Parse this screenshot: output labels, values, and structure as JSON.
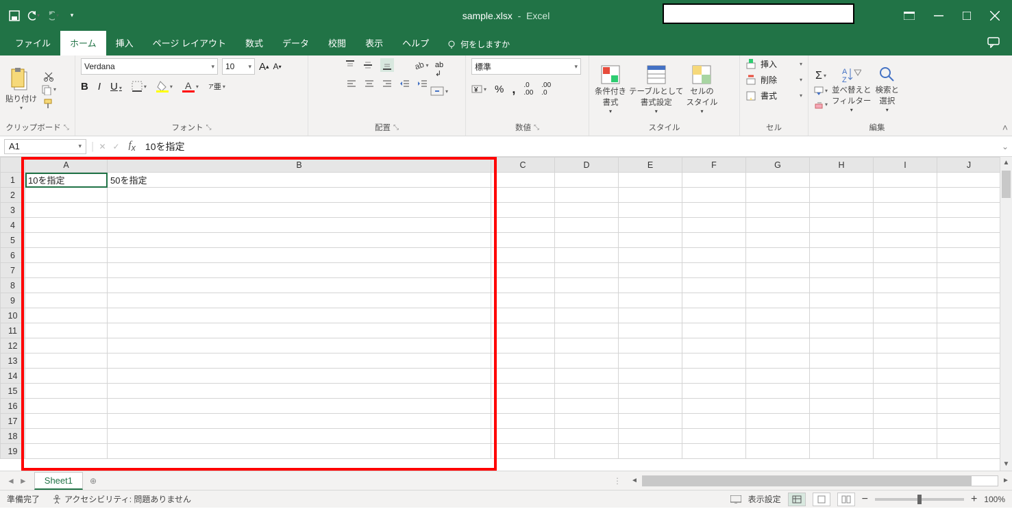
{
  "title": {
    "filename": "sample.xlsx",
    "app": "Excel"
  },
  "qat": {
    "save": "save",
    "undo": "undo",
    "redo": "redo"
  },
  "tabs": {
    "file": "ファイル",
    "home": "ホーム",
    "insert": "挿入",
    "pagelayout": "ページ レイアウト",
    "formulas": "数式",
    "data": "データ",
    "review": "校閲",
    "view": "表示",
    "help": "ヘルプ",
    "tellme": "何をしますか"
  },
  "ribbon": {
    "clipboard": {
      "paste": "貼り付け",
      "label": "クリップボード"
    },
    "font": {
      "name": "Verdana",
      "size": "10",
      "label": "フォント",
      "bold": "B",
      "italic": "I",
      "underline": "U"
    },
    "alignment": {
      "label": "配置",
      "wrap": "ab↲"
    },
    "number": {
      "format": "標準",
      "label": "数値"
    },
    "styles": {
      "cond": "条件付き\n書式",
      "table": "テーブルとして\n書式設定",
      "cell": "セルの\nスタイル",
      "label": "スタイル"
    },
    "cells": {
      "insert": "挿入",
      "delete": "削除",
      "format": "書式",
      "label": "セル"
    },
    "editing": {
      "sort": "並べ替えと\nフィルター",
      "find": "検索と\n選択",
      "label": "編集"
    }
  },
  "namebox": "A1",
  "formula": "10を指定",
  "columns": [
    "A",
    "B",
    "C",
    "D",
    "E",
    "F",
    "G",
    "H",
    "I",
    "J"
  ],
  "rows": [
    "1",
    "2",
    "3",
    "4",
    "5",
    "6",
    "7",
    "8",
    "9",
    "10",
    "11",
    "12",
    "13",
    "14",
    "15",
    "16",
    "17",
    "18",
    "19"
  ],
  "cells": {
    "A1": "10を指定",
    "B1": "50を指定"
  },
  "sheet": {
    "name": "Sheet1"
  },
  "status": {
    "ready": "準備完了",
    "a11y": "アクセシビリティ: 問題ありません",
    "display": "表示設定",
    "zoom": "100%"
  }
}
